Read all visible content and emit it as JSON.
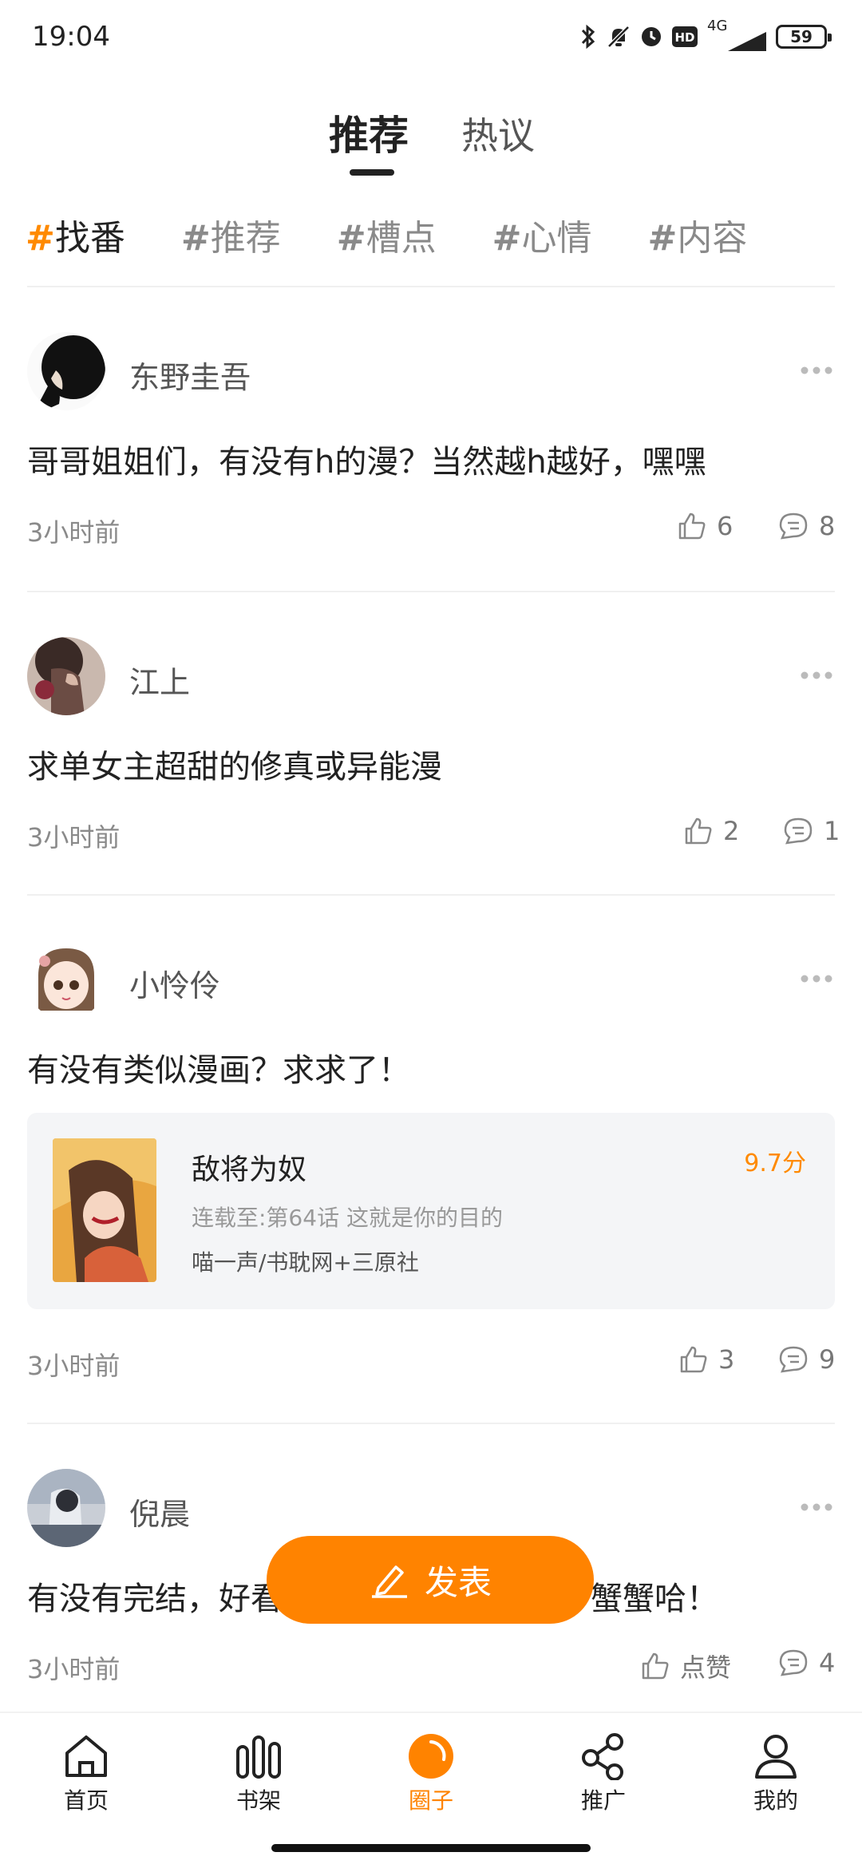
{
  "status_bar": {
    "time": "19:04",
    "network": "4G",
    "battery": "59"
  },
  "top_tabs": [
    {
      "label": "推荐",
      "active": true
    },
    {
      "label": "热议",
      "active": false
    }
  ],
  "hashtags": [
    {
      "hash": "#",
      "label": "找番",
      "active": true
    },
    {
      "hash": "#",
      "label": "推荐",
      "active": false
    },
    {
      "hash": "#",
      "label": "槽点",
      "active": false
    },
    {
      "hash": "#",
      "label": "心情",
      "active": false
    },
    {
      "hash": "#",
      "label": "内容",
      "active": false
    }
  ],
  "posts": [
    {
      "username": "东野圭吾",
      "text": "哥哥姐姐们，有没有h的漫？当然越h越好，嘿嘿",
      "time": "3小时前",
      "likes": "6",
      "comments": "8"
    },
    {
      "username": "江上",
      "text": "求单女主超甜的修真或异能漫",
      "time": "3小时前",
      "likes": "2",
      "comments": "1"
    },
    {
      "username": "小怜伶",
      "text": "有没有类似漫画？求求了！",
      "time": "3小时前",
      "likes": "3",
      "comments": "9",
      "comic": {
        "title": "敌将为奴",
        "score": "9.7分",
        "progress": "连载至:第64话 这就是你的目的",
        "authors": "喵一声/书耽网+三原社"
      }
    },
    {
      "username": "倪晨",
      "text_left": "有没有完结，好看",
      "text_right": "蟹蟹哈！",
      "time": "3小时前",
      "likes": "点赞",
      "comments": "4"
    }
  ],
  "fab": {
    "label": "发表"
  },
  "bottom_nav": [
    {
      "label": "首页",
      "icon": "home-icon",
      "active": false
    },
    {
      "label": "书架",
      "icon": "bookshelf-icon",
      "active": false
    },
    {
      "label": "圈子",
      "icon": "circle-icon",
      "active": true
    },
    {
      "label": "推广",
      "icon": "share-icon",
      "active": false
    },
    {
      "label": "我的",
      "icon": "profile-icon",
      "active": false
    }
  ],
  "colors": {
    "accent": "#ff8300",
    "text": "#222222",
    "muted": "#8a8a8a",
    "card_bg": "#f4f5f7"
  }
}
